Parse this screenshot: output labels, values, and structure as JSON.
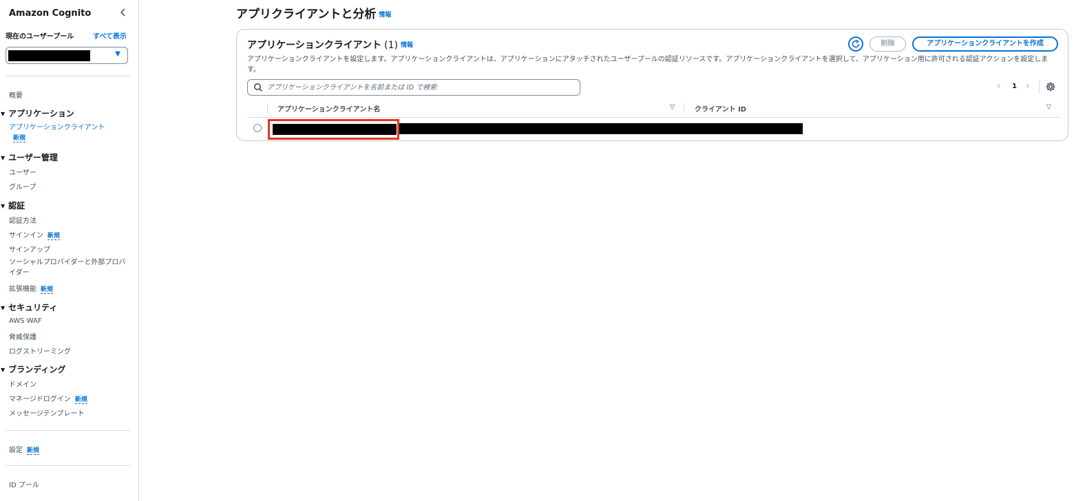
{
  "sidebar": {
    "title": "Amazon Cognito",
    "collapse_icon": "chevron-left-icon",
    "current_pool_label": "現在のユーザープール",
    "show_all": "すべて表示",
    "badge_new": "新規",
    "overview": "概要",
    "sections": {
      "application": {
        "label": "アプリケーション",
        "items": [
          "アプリケーションクライアント"
        ]
      },
      "user_management": {
        "label": "ユーザー管理",
        "items": [
          "ユーザー",
          "グループ"
        ]
      },
      "authentication": {
        "label": "認証",
        "items": [
          "認証方法",
          "サインイン",
          "サインアップ",
          "ソーシャルプロバイダーと外部プロバイダー",
          "拡張機能"
        ]
      },
      "security": {
        "label": "セキュリティ",
        "items": [
          "AWS WAF",
          "脅威保護",
          "ログストリーミング"
        ]
      },
      "branding": {
        "label": "ブランディング",
        "items": [
          "ドメイン",
          "マネージドログイン",
          "メッセージテンプレート"
        ]
      }
    },
    "settings": "設定",
    "id_pool": "ID プール"
  },
  "main": {
    "page_title": "アプリクライアントと分析",
    "info": "情報",
    "panel": {
      "title": "アプリケーションクライアント",
      "count": "(1)",
      "description": "アプリケーションクライアントを設定します。アプリケーションクライアントは、アプリケーションにアタッチされたユーザープールの認証リソースです。アプリケーションクライアントを選択して、アプリケーション用に許可される認証アクションを設定します。",
      "refresh_icon": "refresh-icon",
      "delete_label": "削除",
      "create_label": "アプリケーションクライアントを作成",
      "search_placeholder": "アプリケーションクライアントを名前または ID で検索",
      "page_number": "1",
      "columns": [
        "アプリケーションクライアント名",
        "クライアント ID"
      ]
    }
  },
  "colors": {
    "accent": "#0972d3",
    "highlight": "#e8321f",
    "text": "#16191f"
  }
}
